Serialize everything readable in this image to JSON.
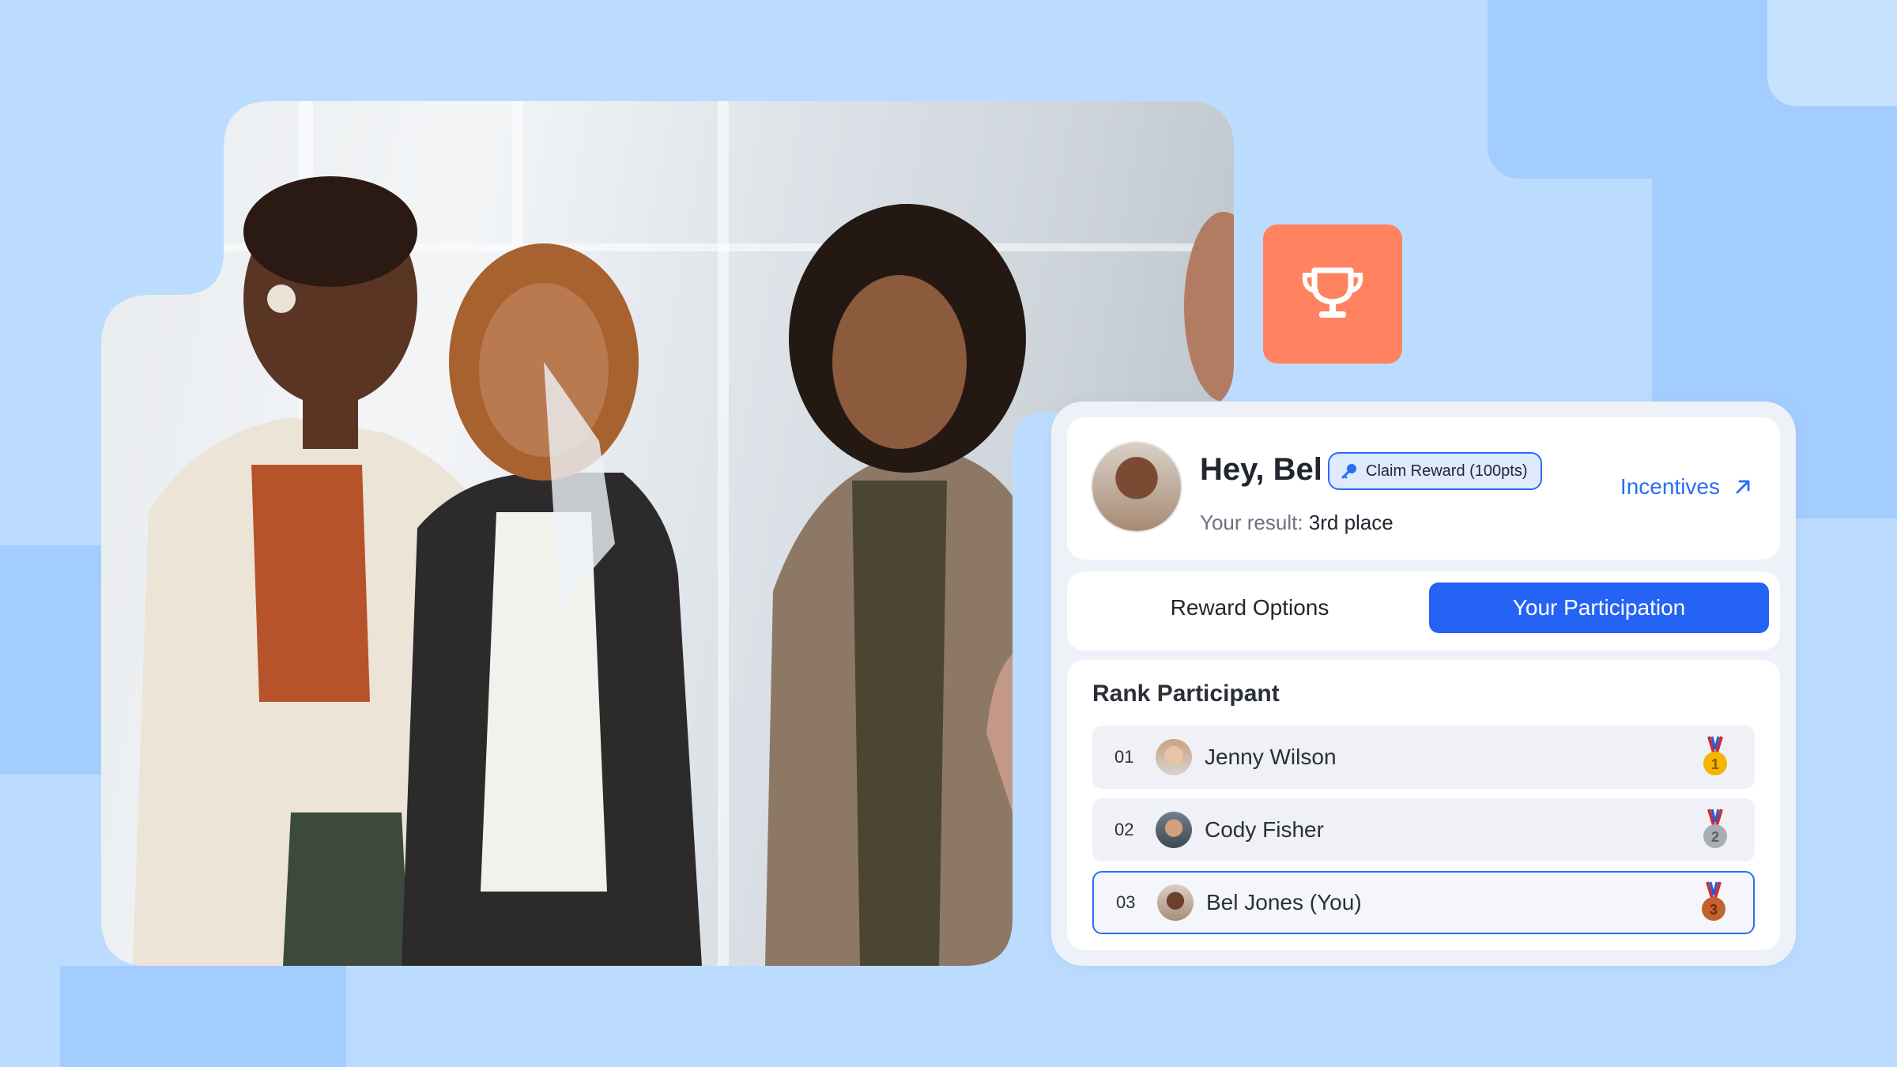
{
  "colors": {
    "background": "#bcdcff",
    "accent_blue": "#2563f5",
    "trophy_tile": "#ff8360",
    "gold": "#f4b400",
    "silver": "#a9adb4",
    "bronze": "#c4622d"
  },
  "trophy_tile": {
    "icon": "trophy-icon"
  },
  "header": {
    "greeting": "Hey, Bel",
    "claim_badge": {
      "icon": "key-icon",
      "label": "Claim Reward (100pts)"
    },
    "result_label": "Your result:",
    "result_value": "3rd place",
    "incentives_link": {
      "label": "Incentives",
      "icon": "arrow-up-right-icon"
    }
  },
  "tabs": [
    {
      "label": "Reward Options",
      "active": false
    },
    {
      "label": "Your Participation",
      "active": true
    }
  ],
  "leaderboard": {
    "title": "Rank Participant",
    "rows": [
      {
        "rank": "01",
        "name": "Jenny Wilson",
        "medal": "1",
        "medal_icon": "gold-medal-icon"
      },
      {
        "rank": "02",
        "name": "Cody Fisher",
        "medal": "2",
        "medal_icon": "silver-medal-icon"
      },
      {
        "rank": "03",
        "name": "Bel Jones (You)",
        "medal": "3",
        "medal_icon": "bronze-medal-icon",
        "is_you": true
      }
    ]
  }
}
